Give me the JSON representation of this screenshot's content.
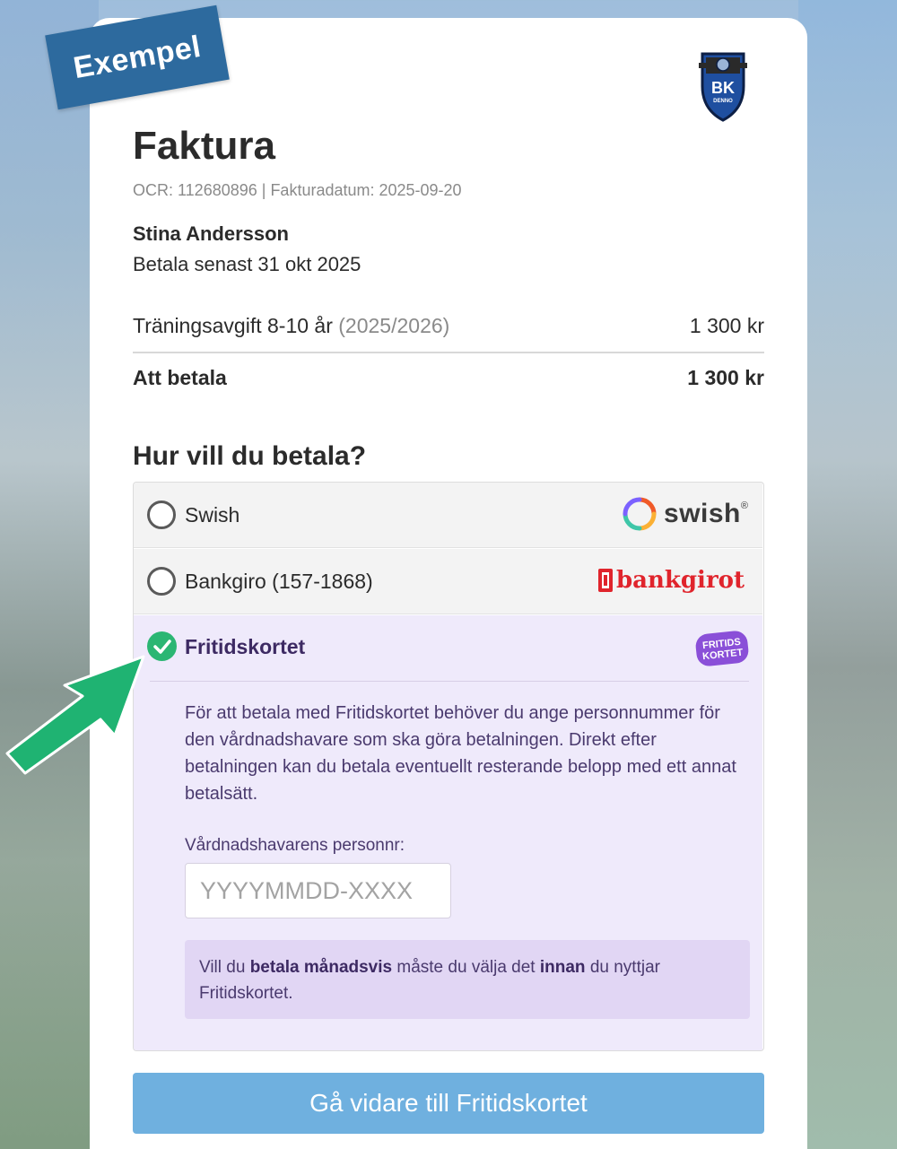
{
  "badge": {
    "label": "Exempel"
  },
  "logo": {
    "text": "BK",
    "subtext": "DENNO"
  },
  "invoice": {
    "title": "Faktura",
    "meta": "OCR: 112680896 | Fakturadatum: 2025-09-20",
    "payer": "Stina Andersson",
    "due": "Betala senast 31 okt 2025"
  },
  "line_item": {
    "label": "Träningsavgift 8-10 år",
    "season": "(2025/2026)",
    "amount": "1 300 kr"
  },
  "total": {
    "label": "Att betala",
    "amount": "1 300 kr"
  },
  "payment": {
    "question": "Hur vill du betala?",
    "swish": {
      "label": "Swish",
      "logo_text": "swish",
      "logo_mark": "®"
    },
    "bankgiro": {
      "label": "Bankgiro (157-1868)",
      "logo_text": "bankgirot"
    },
    "fritids": {
      "label": "Fritidskortet",
      "logo_line1": "FRITIDS",
      "logo_line2": "KORTET",
      "description": "För att betala med Fritidskortet behöver du ange personnummer för den vårdnadshavare som ska göra betalningen. Direkt efter betalningen kan du betala eventuellt resterande belopp med ett annat betalsätt.",
      "field_label": "Vårdnadshavarens personnr:",
      "field_placeholder": "YYYYMMDD-XXXX",
      "field_value": "",
      "notice_part1": "Vill du ",
      "notice_bold1": "betala månadsvis",
      "notice_part2": " måste du välja det ",
      "notice_bold2": "innan",
      "notice_part3": " du nyttjar Fritidskortet."
    }
  },
  "cta": {
    "label": "Gå vidare till Fritidskortet"
  },
  "colors": {
    "badge": "#2d6a9e",
    "accent_green": "#2bb673",
    "fritids_bg": "#efeafb",
    "notice_bg": "#e1d6f4",
    "cta": "#6fb0df",
    "bankgirot_red": "#e0242c"
  },
  "icons": {
    "selected": "check-circle-icon",
    "unselected": "radio-icon",
    "pointer": "arrow-icon"
  }
}
